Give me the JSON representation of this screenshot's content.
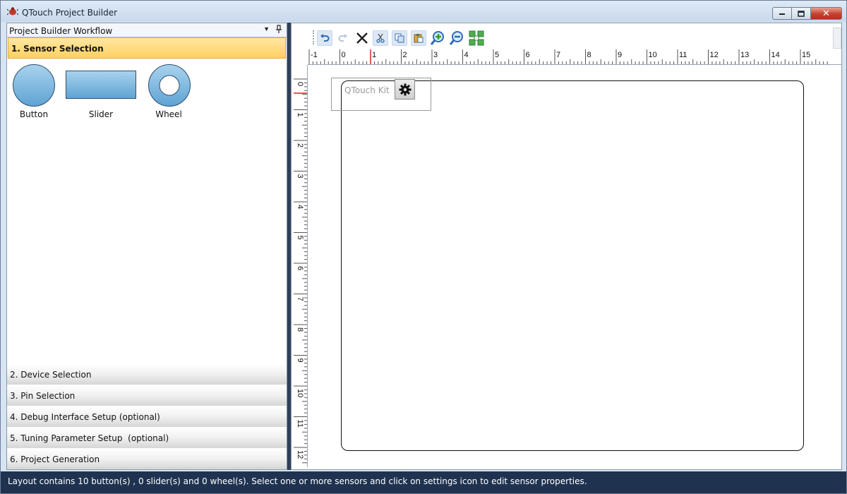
{
  "window": {
    "title": "QTouch Project Builder",
    "minimize_icon": "minimize-icon",
    "maximize_icon": "restore-icon",
    "close_label": "✕"
  },
  "left_panel": {
    "header_title": "Project Builder Workflow",
    "dropdown_glyph": "▼",
    "pin_glyph": "ᵽ",
    "active_step": "1. Sensor Selection",
    "sensors": [
      {
        "label": "Button",
        "icon": "button-sensor-icon"
      },
      {
        "label": "Slider",
        "icon": "slider-sensor-icon"
      },
      {
        "label": "Wheel",
        "icon": "wheel-sensor-icon"
      }
    ],
    "steps": [
      "2. Device Selection",
      "3. Pin Selection",
      "4. Debug Interface Setup (optional)",
      "5. Tuning Parameter Setup  (optional)",
      "6. Project Generation"
    ]
  },
  "toolbar": {
    "buttons": [
      "undo-icon",
      "redo-icon",
      "delete-icon",
      "cut-icon",
      "copy-icon",
      "paste-icon",
      "zoom-in-icon",
      "zoom-out-icon",
      "fit-to-window-icon"
    ]
  },
  "rulers": {
    "horizontal": [
      "-1",
      "0",
      "1",
      "2",
      "3",
      "4",
      "5",
      "6",
      "7",
      "8",
      "9",
      "10",
      "11",
      "12",
      "13",
      "14",
      "15"
    ],
    "vertical": [
      "0",
      "1",
      "2",
      "3",
      "4",
      "5",
      "6",
      "7",
      "8",
      "9",
      "10",
      "11",
      "12"
    ]
  },
  "canvas": {
    "kit_label": "QTouch Kit",
    "settings_icon": "gear-icon"
  },
  "status": {
    "text": "Layout contains 10 button(s) , 0 slider(s) and  0 wheel(s). Select one or more sensors and click on settings icon to edit sensor properties."
  },
  "colors": {
    "active_step": "#ffd060",
    "status_bar": "#1f3350",
    "splitter": "#2f3f58",
    "sensor_fill": "#7fb7de"
  }
}
